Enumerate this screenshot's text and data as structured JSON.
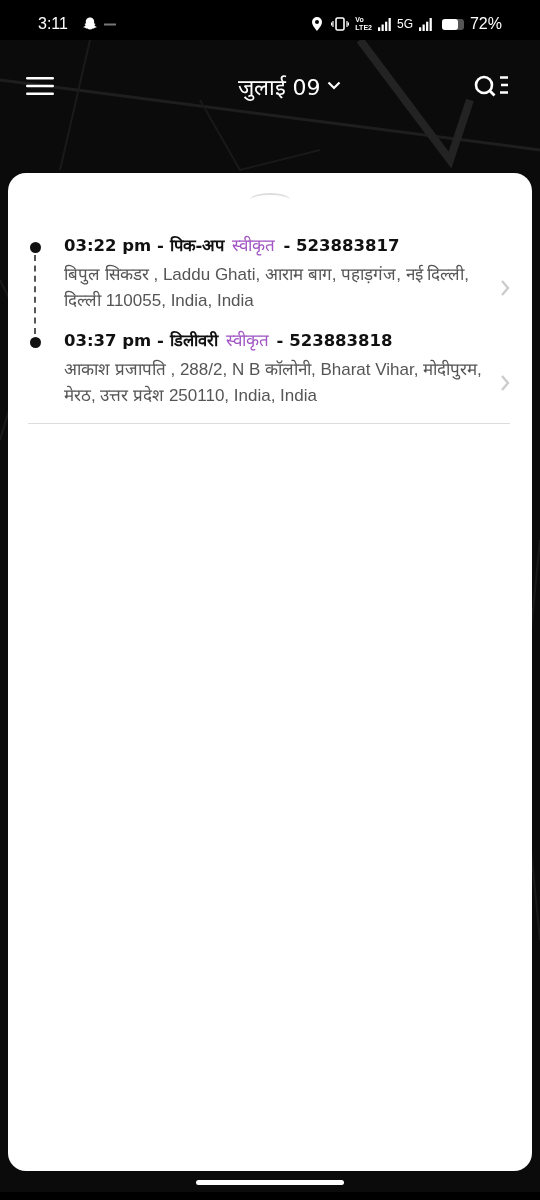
{
  "status_bar": {
    "time": "3:11",
    "volte_top": "Vo",
    "volte_bottom": "LTE2",
    "network": "5G",
    "battery": "72%"
  },
  "header": {
    "title": "जुलाई 09"
  },
  "stops": [
    {
      "heading": "03:22 pm - पिक-अप",
      "status": "स्वीकृत",
      "order": "- 523883817",
      "address": "बिपुल सिकडर , Laddu Ghati, आराम बाग, पहाड़गंज, नई दिल्ली, दिल्ली 110055, India, India"
    },
    {
      "heading": "03:37 pm - डिलीवरी",
      "status": "स्वीकृत",
      "order": "- 523883818",
      "address": "आकाश प्रजापति , 288/2, N B कॉलोनी, Bharat Vihar, मोदीपुरम, मेरठ, उत्तर प्रदेश 250110, India, India"
    }
  ]
}
